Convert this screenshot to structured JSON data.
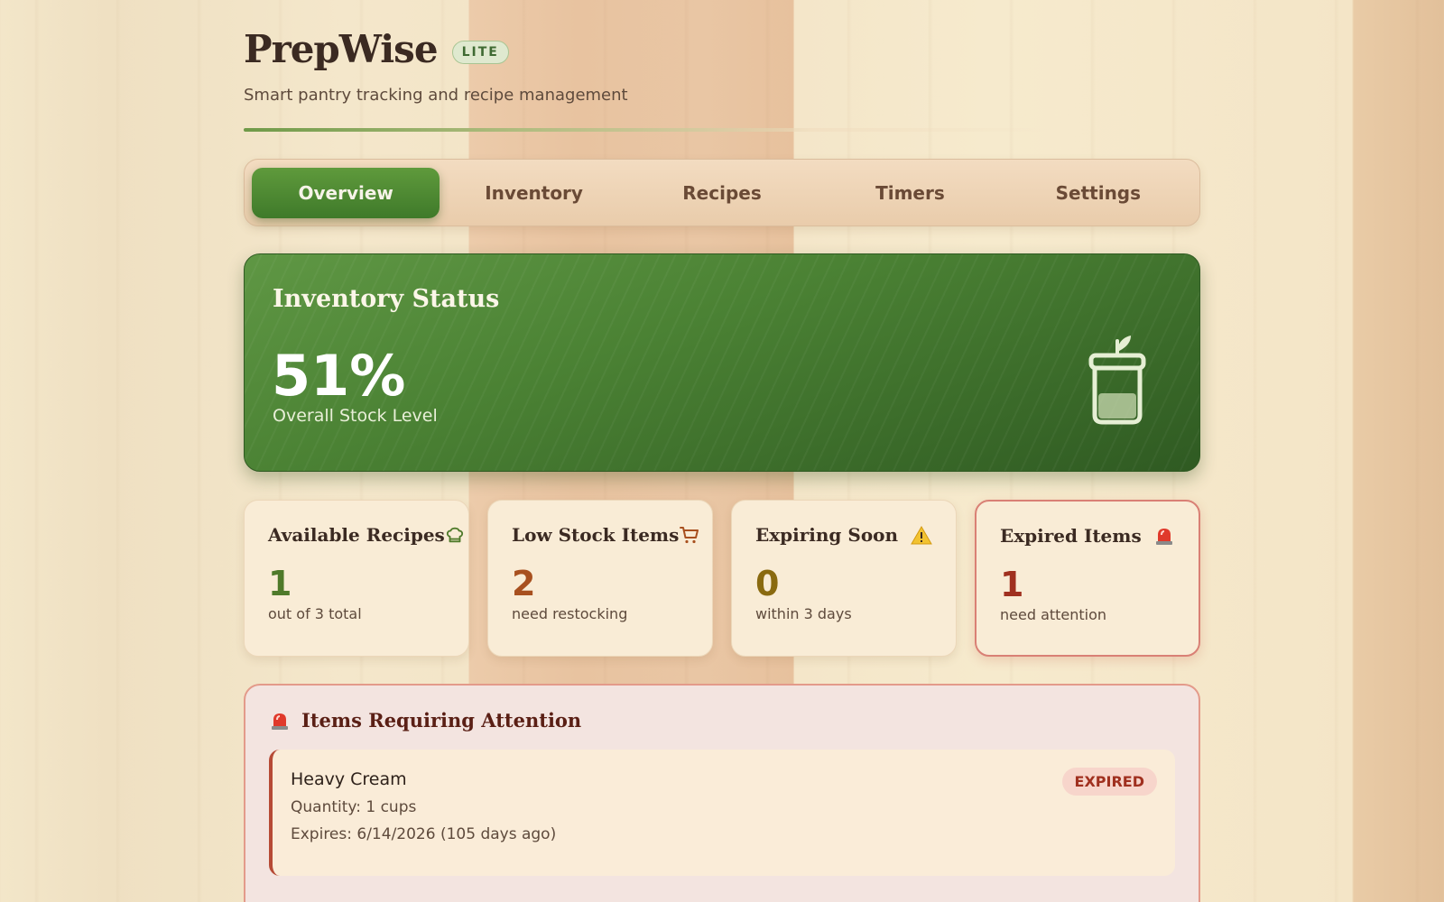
{
  "app": {
    "title": "PrepWise",
    "badge": "LITE",
    "subtitle": "Smart pantry tracking and recipe management"
  },
  "tabs": [
    {
      "label": "Overview",
      "active": true
    },
    {
      "label": "Inventory",
      "active": false
    },
    {
      "label": "Recipes",
      "active": false
    },
    {
      "label": "Timers",
      "active": false
    },
    {
      "label": "Settings",
      "active": false
    }
  ],
  "inventory_status": {
    "title": "Inventory Status",
    "value": "51%",
    "label": "Overall Stock Level",
    "icon": "jar-icon"
  },
  "stats": [
    {
      "title": "Available Recipes",
      "value": "1",
      "sub": "out of 3 total",
      "icon": "chef-hat-icon",
      "color": "#4f7a2a"
    },
    {
      "title": "Low Stock Items",
      "value": "2",
      "sub": "need restocking",
      "icon": "cart-icon",
      "color": "#a8501f"
    },
    {
      "title": "Expiring Soon",
      "value": "0",
      "sub": "within 3 days",
      "icon": "warning-icon",
      "color": "#8a6a10"
    },
    {
      "title": "Expired Items",
      "value": "1",
      "sub": "need attention",
      "icon": "siren-icon",
      "color": "#a0301f"
    }
  ],
  "attention": {
    "title": "Items Requiring Attention",
    "icon": "siren-icon",
    "items": [
      {
        "name": "Heavy Cream",
        "badge": "EXPIRED",
        "quantity_label": "Quantity:",
        "quantity": "1 cups",
        "expires_label": "Expires:",
        "expires": "6/14/2026 (105 days ago)"
      }
    ]
  },
  "colors": {
    "accent_green": "#4b8234",
    "alert_red": "#a0301f",
    "background": "#f3e6c9"
  }
}
